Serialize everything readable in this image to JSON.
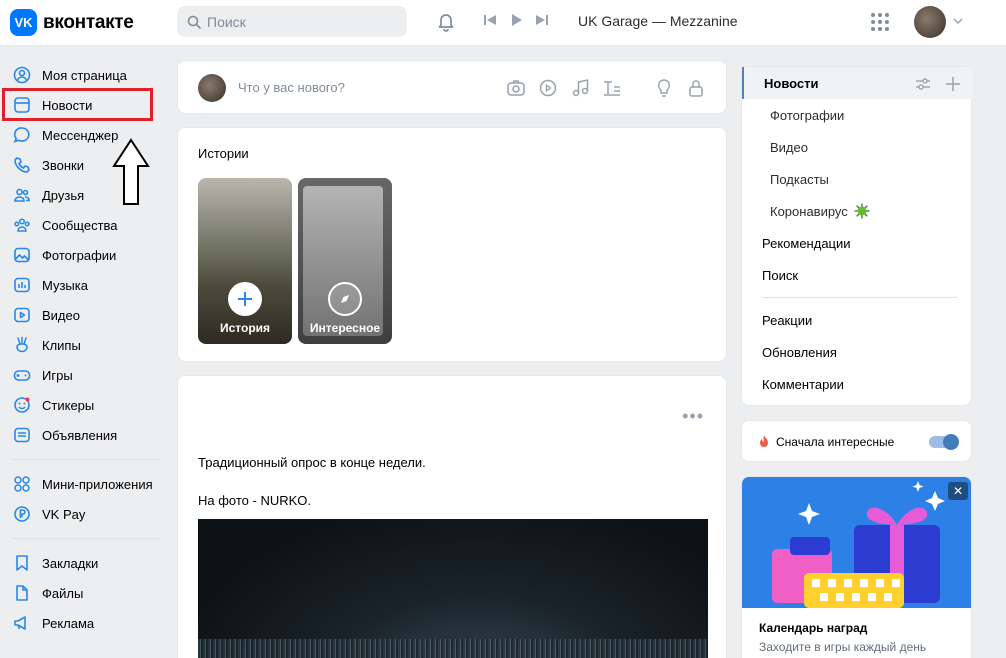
{
  "header": {
    "logo_text": "вконтакте",
    "logo_mark": "VK",
    "search_placeholder": "Поиск",
    "now_playing": "UK Garage — Mezzanine"
  },
  "sidebar": {
    "items": [
      {
        "label": "Моя страница",
        "icon": "user-icon"
      },
      {
        "label": "Новости",
        "icon": "news-icon"
      },
      {
        "label": "Мессенджер",
        "icon": "message-icon"
      },
      {
        "label": "Звонки",
        "icon": "phone-icon"
      },
      {
        "label": "Друзья",
        "icon": "friends-icon"
      },
      {
        "label": "Сообщества",
        "icon": "groups-icon"
      },
      {
        "label": "Фотографии",
        "icon": "photo-icon"
      },
      {
        "label": "Музыка",
        "icon": "music-icon"
      },
      {
        "label": "Видео",
        "icon": "video-icon"
      },
      {
        "label": "Клипы",
        "icon": "clips-icon"
      },
      {
        "label": "Игры",
        "icon": "gamepad-icon"
      },
      {
        "label": "Стикеры",
        "icon": "sticker-icon"
      },
      {
        "label": "Объявления",
        "icon": "classifieds-icon"
      }
    ],
    "items2": [
      {
        "label": "Мини-приложения",
        "icon": "apps-icon"
      },
      {
        "label": "VK Pay",
        "icon": "vkpay-icon"
      }
    ],
    "items3": [
      {
        "label": "Закладки",
        "icon": "bookmark-icon"
      },
      {
        "label": "Файлы",
        "icon": "files-icon"
      },
      {
        "label": "Реклама",
        "icon": "ads-icon"
      }
    ]
  },
  "composer": {
    "placeholder": "Что у вас нового?"
  },
  "stories": {
    "title": "Истории",
    "items": [
      {
        "label": "История"
      },
      {
        "label": "Интересное"
      }
    ]
  },
  "post": {
    "text1": "Традиционный опрос в конце недели.",
    "text2": "На фото - NURKO."
  },
  "right_menu": {
    "active": "Новости",
    "subs": [
      "Фотографии",
      "Видео",
      "Подкасты",
      "Коронавирус"
    ],
    "items": [
      "Рекомендации",
      "Поиск"
    ],
    "items2": [
      "Реакции",
      "Обновления",
      "Комментарии"
    ]
  },
  "sort": {
    "label": "Сначала интересные",
    "enabled": true
  },
  "promo": {
    "title": "Календарь наград",
    "subtitle": "Заходите в игры каждый день",
    "close": "✕"
  },
  "colors": {
    "accent": "#0077ff",
    "highlight": "#e0202a",
    "icon": "#2688eb"
  }
}
